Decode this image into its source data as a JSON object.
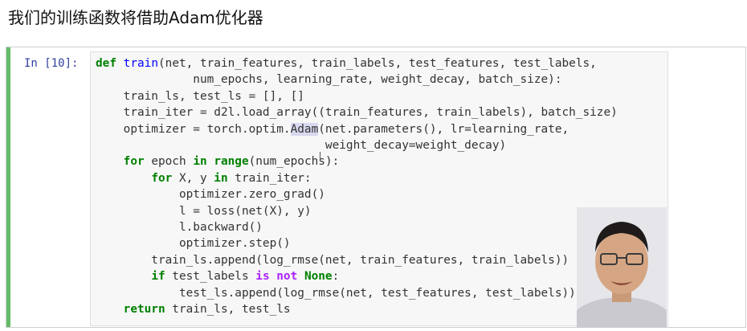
{
  "heading": "我们的训练函数将借助Adam优化器",
  "cell": {
    "prompt": "In [10]:",
    "code": {
      "l1_kw": "def",
      "l1_fn": "train",
      "l1_rest": "(net, train_features, train_labels, test_features, test_labels,",
      "l2": "              num_epochs, learning_rate, weight_decay, batch_size):",
      "l3": "    train_ls, test_ls = [], []",
      "l4": "    train_iter = d2l.load_array((train_features, train_labels), batch_size)",
      "l5_a": "    optimizer = torch.optim.",
      "l5_sel": "Adam",
      "l5_b": "(net.parameters(), lr=learning_rate,",
      "l6": "                                 weight_decay=weight_decay)",
      "l7_kw": "for",
      "l7_a": " epoch ",
      "l7_in": "in",
      "l7_fn": "range",
      "l7_b": "(num_epochs):",
      "l8_kw": "for",
      "l8_a": " X, y ",
      "l8_in": "in",
      "l8_b": " train_iter:",
      "l9": "            optimizer.zero_grad()",
      "l10": "            l = loss(net(X), y)",
      "l11": "            l.backward()",
      "l12": "            optimizer.step()",
      "l13": "        train_ls.append(log_rmse(net, train_features, train_labels))",
      "l14_kw": "if",
      "l14_a": " test_labels ",
      "l14_is": "is not",
      "l14_none": "None",
      "l14_b": ":",
      "l15": "            test_ls.append(log_rmse(net, test_features, test_labels))",
      "l16_kw": "return",
      "l16_b": " train_ls, test_ls"
    }
  },
  "colors": {
    "keyword": "#008000",
    "builtin": "#0000ff",
    "operator_word": "#aa22ff",
    "prompt": "#303f9f",
    "cell_bar": "#66bb6a"
  },
  "overlay": {
    "icon": "webcam-presenter-icon"
  }
}
